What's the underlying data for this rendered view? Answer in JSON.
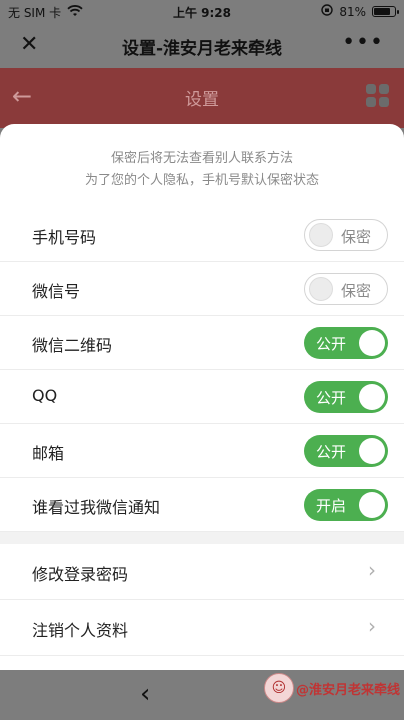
{
  "status_bar": {
    "carrier": "无 SIM 卡",
    "wifi_icon": "wifi-icon",
    "time": "上午 9:28",
    "lock_icon": "orientation-lock-icon",
    "battery": "81%",
    "battery_level": 0.81
  },
  "title_bar": {
    "close_icon": "close-icon",
    "title": "设置-淮安月老来牵线",
    "more_icon": "more-icon"
  },
  "app_header": {
    "back_icon": "back-arrow-icon",
    "title": "设置",
    "grid_icon": "grid-icon"
  },
  "notice": {
    "line1": "保密后将无法查看别人联系方法",
    "line2": "为了您的个人隐私，手机号默认保密状态"
  },
  "privacy_items": [
    {
      "label": "手机号码",
      "state": "保密",
      "on": false
    },
    {
      "label": "微信号",
      "state": "保密",
      "on": false
    },
    {
      "label": "微信二维码",
      "state": "公开",
      "on": true
    },
    {
      "label": "QQ",
      "state": "公开",
      "on": true
    },
    {
      "label": "邮箱",
      "state": "公开",
      "on": true
    },
    {
      "label": "谁看过我微信通知",
      "state": "开启",
      "on": true
    }
  ],
  "nav_items": [
    {
      "label": "修改登录密码"
    },
    {
      "label": "注销个人资料"
    }
  ],
  "bottom_bar": {
    "back_icon": "chevron-left-icon"
  },
  "watermark": {
    "text": "@淮安月老来牵线"
  },
  "colors": {
    "toggle_on": "#4caf50",
    "header_bg": "#8a3a3a",
    "watermark_text": "#c03434"
  }
}
